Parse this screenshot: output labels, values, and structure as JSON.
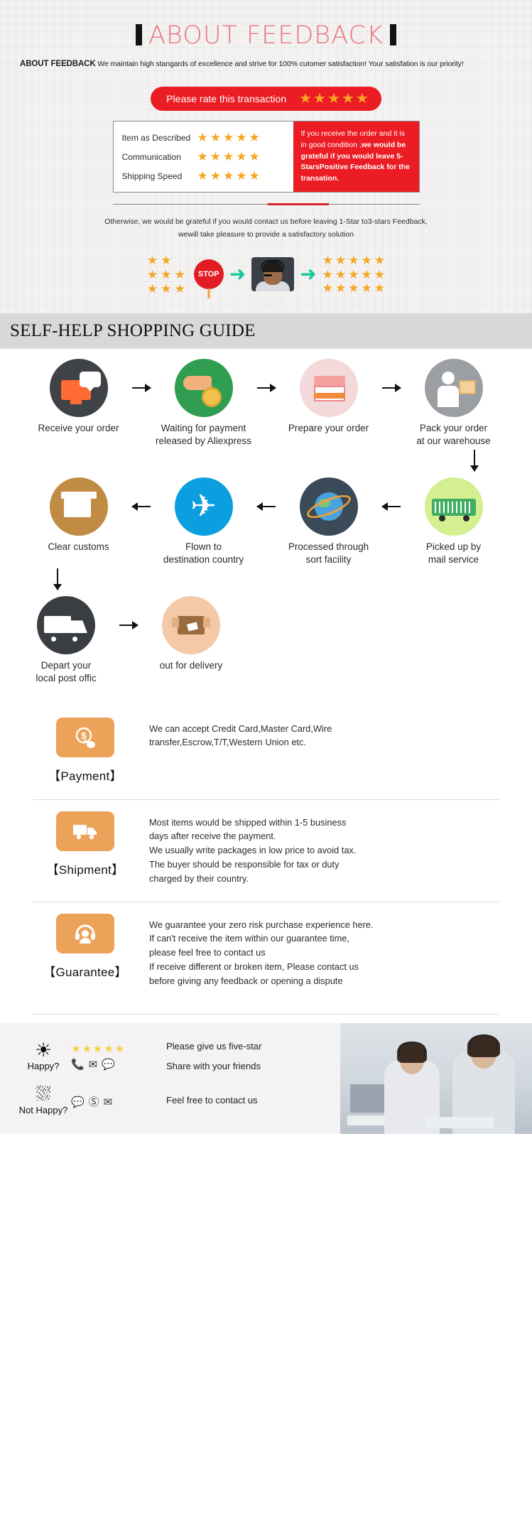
{
  "feedback": {
    "title": "ABOUT FEEDBACK",
    "subtitle_bold": "ABOUT FEEDBACK",
    "subtitle_rest": "We maintain high stangards of excellence and strive for 100% cutomer satisfaction! Your satisfation is our priority!",
    "rate_pill_label": "Please rate this transaction",
    "rate_pill_stars": "★★★★★",
    "criteria": [
      {
        "name": "Item as Described",
        "stars": "★★★★★"
      },
      {
        "name": "Communication",
        "stars": "★★★★★"
      },
      {
        "name": "Shipping Speed",
        "stars": "★★★★★"
      }
    ],
    "note_line1": "If you receive the order and it is in good",
    "note_line2_pre": "condition ,",
    "note_line2_bold": "we would be grateful if you",
    "note_line3_bold": "would leave 5-StarsPositive Feedback",
    "note_line4_bold": "for the transation.",
    "otherwise_line1": "Otherwise, we would be grateful if you would contact us before leaving 1-Star to3-stars Feedback,",
    "otherwise_line2": "wewill take pleasure to provide a satisfactory solution",
    "stop_label": "STOP"
  },
  "guide": {
    "banner": "SELF-HELP SHOPPING GUIDE",
    "steps_row1": [
      {
        "caption": "Receive your order"
      },
      {
        "caption": "Waiting for payment\nreleased by Aliexpress"
      },
      {
        "caption": "Prepare your order"
      },
      {
        "caption": "Pack your order\nat our warehouse"
      }
    ],
    "steps_row2": [
      {
        "caption": "Clear customs"
      },
      {
        "caption": "Flown to\ndestination country"
      },
      {
        "caption": "Processed through\nsort facility"
      },
      {
        "caption": "Picked up by\nmail service"
      }
    ],
    "steps_row3": [
      {
        "caption": "Depart your\nlocal post offic"
      },
      {
        "caption": "out for delivery"
      }
    ]
  },
  "info": [
    {
      "title": "【Payment】",
      "icon": "money-hand-icon",
      "lines": [
        "We can accept Credit Card,Master Card,Wire",
        "transfer,Escrow,T/T,Western Union etc."
      ]
    },
    {
      "title": "【Shipment】",
      "icon": "truck-icon",
      "lines": [
        "Most items would be shipped within 1-5 business",
        "days after receive the payment.",
        "We usually write packages in low price to avoid tax.",
        "The buyer should be responsible for tax or duty",
        "charged by their country."
      ]
    },
    {
      "title": "【Guarantee】",
      "icon": "headset-icon",
      "lines": [
        "We guarantee your zero risk purchase experience here.",
        "If can't receive the item within our guarantee time,",
        "please feel free to contact us",
        "If receive different or broken item, Please contact us",
        "before giving any feedback or opening a dispute"
      ]
    }
  ],
  "contact": {
    "happy_label": "Happy?",
    "not_happy_label": "Not Happy?",
    "happy_stars": "★★★★★",
    "happy_icons": "📞✉💬",
    "not_happy_icons": "💬Ⓢ✉",
    "happy_text_1": "Please give us five-star",
    "happy_text_2": "Share with your friends",
    "not_happy_text": "Feel free to contact us"
  },
  "colors": {
    "red": "#ec1c24",
    "star_gold": "#f5a623",
    "orange_badge": "#eda25a",
    "title_pink": "#e8737d",
    "banner_grey": "#d8d8d8"
  }
}
